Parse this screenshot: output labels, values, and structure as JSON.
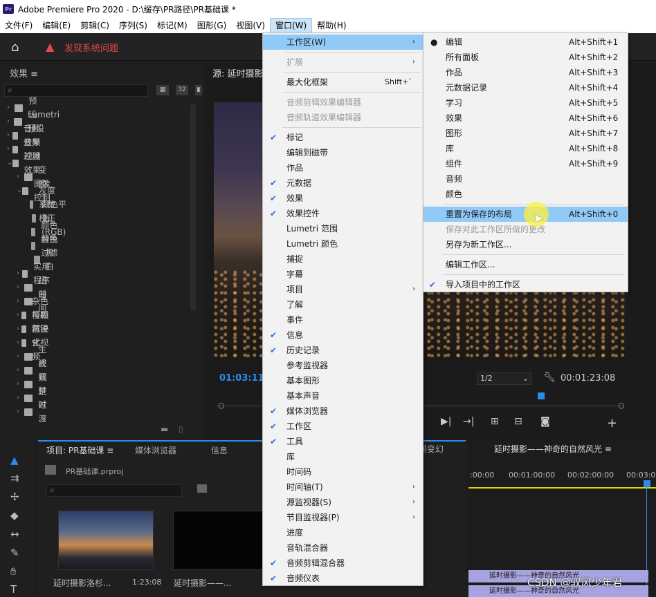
{
  "window_title": "Adobe Premiere Pro 2020 - D:\\缓存\\PR路径\\PR基础课 *",
  "app_logo": "Pr",
  "menubar": [
    "文件(F)",
    "编辑(E)",
    "剪辑(C)",
    "序列(S)",
    "标记(M)",
    "图形(G)",
    "视图(V)",
    "窗口(W)",
    "帮助(H)"
  ],
  "header": {
    "warning": "发现系统问题"
  },
  "effects": {
    "title": "效果",
    "tree": [
      {
        "label": "预设",
        "indent": 0,
        "kind": "folder",
        "open": false
      },
      {
        "label": "Lumetri 预设",
        "indent": 0,
        "kind": "folder",
        "open": false
      },
      {
        "label": "音频效果",
        "indent": 0,
        "kind": "folder",
        "open": false
      },
      {
        "label": "音频过渡",
        "indent": 0,
        "kind": "folder",
        "open": false
      },
      {
        "label": "视频效果",
        "indent": 0,
        "kind": "folder",
        "open": true
      },
      {
        "label": "变换",
        "indent": 1,
        "kind": "folder",
        "open": false
      },
      {
        "label": "图像控制",
        "indent": 1,
        "kind": "folder",
        "open": true
      },
      {
        "label": "灰度系数校正",
        "indent": 2,
        "kind": "fx"
      },
      {
        "label": "颜色平衡 (RGB)",
        "indent": 2,
        "kind": "fx"
      },
      {
        "label": "颜色替换",
        "indent": 2,
        "kind": "fx"
      },
      {
        "label": "颜色过滤",
        "indent": 2,
        "kind": "fx"
      },
      {
        "label": "黑白",
        "indent": 2,
        "kind": "fx"
      },
      {
        "label": "实用程序",
        "indent": 1,
        "kind": "folder",
        "open": false
      },
      {
        "label": "扭曲",
        "indent": 1,
        "kind": "folder",
        "open": false
      },
      {
        "label": "时间",
        "indent": 1,
        "kind": "folder",
        "open": false
      },
      {
        "label": "杂色与颗粒",
        "indent": 1,
        "kind": "folder",
        "open": false
      },
      {
        "label": "模糊与锐化",
        "indent": 1,
        "kind": "folder",
        "open": false
      },
      {
        "label": "沉浸式视频",
        "indent": 1,
        "kind": "folder",
        "open": false
      },
      {
        "label": "生成",
        "indent": 1,
        "kind": "folder",
        "open": false
      },
      {
        "label": "视频",
        "indent": 1,
        "kind": "folder",
        "open": false
      },
      {
        "label": "调整",
        "indent": 1,
        "kind": "folder",
        "open": false
      },
      {
        "label": "过时",
        "indent": 1,
        "kind": "folder",
        "open": false
      },
      {
        "label": "过渡",
        "indent": 1,
        "kind": "folder",
        "open": false
      }
    ],
    "tool_badges": [
      "32"
    ]
  },
  "source": {
    "tab": "源: 延时摄影",
    "timecode_in": "01:03:11:",
    "zoom": "1/2",
    "timecode_out": "00:01:23:08"
  },
  "project": {
    "tabs": [
      "项目: PR基础课",
      "媒体浏览器",
      "信息"
    ],
    "file": "PR基础课.prproj",
    "clips": [
      {
        "name": "延时摄影洛杉...",
        "duration": "1:23:08"
      },
      {
        "name": "延时摄影——..."
      }
    ]
  },
  "timeline": {
    "tab": "延时摄影——神奇的自然风光",
    "partial_tab": "间变幻",
    "ruler": [
      ":00:00",
      "00:01:00:00",
      "00:02:00:00",
      "00:03:00"
    ],
    "clip_label": "延时摄影——神奇的自然风光"
  },
  "window_menu": [
    {
      "label": "工作区(W)",
      "arrow": true,
      "highlight": true
    },
    {
      "sep": true
    },
    {
      "label": "扩展",
      "arrow": true,
      "disabled": true
    },
    {
      "sep": true
    },
    {
      "label": "最大化框架",
      "shortcut": "Shift+`"
    },
    {
      "sep": true
    },
    {
      "label": "音频剪辑效果编辑器",
      "disabled": true
    },
    {
      "label": "音频轨道效果编辑器",
      "disabled": true
    },
    {
      "sep": true
    },
    {
      "label": "标记",
      "checked": true
    },
    {
      "label": "编辑到磁带"
    },
    {
      "label": "作品"
    },
    {
      "label": "元数据",
      "checked": true
    },
    {
      "label": "效果",
      "checked": true
    },
    {
      "label": "效果控件",
      "checked": true
    },
    {
      "label": "Lumetri 范围"
    },
    {
      "label": "Lumetri 颜色"
    },
    {
      "label": "捕捉"
    },
    {
      "label": "字幕"
    },
    {
      "label": "项目",
      "arrow": true
    },
    {
      "label": "了解"
    },
    {
      "label": "事件"
    },
    {
      "label": "信息",
      "checked": true
    },
    {
      "label": "历史记录",
      "checked": true
    },
    {
      "label": "参考监视器"
    },
    {
      "label": "基本图形"
    },
    {
      "label": "基本声音"
    },
    {
      "label": "媒体浏览器",
      "checked": true
    },
    {
      "label": "工作区",
      "checked": true
    },
    {
      "label": "工具",
      "checked": true
    },
    {
      "label": "库"
    },
    {
      "label": "时间码"
    },
    {
      "label": "时间轴(T)",
      "arrow": true
    },
    {
      "label": "源监视器(S)",
      "arrow": true
    },
    {
      "label": "节目监视器(P)",
      "arrow": true
    },
    {
      "label": "进度"
    },
    {
      "label": "音轨混合器"
    },
    {
      "label": "音频剪辑混合器",
      "checked": true
    },
    {
      "label": "音频仪表",
      "checked": true
    }
  ],
  "workspace_menu": [
    {
      "label": "编辑",
      "shortcut": "Alt+Shift+1",
      "dot": true
    },
    {
      "label": "所有面板",
      "shortcut": "Alt+Shift+2"
    },
    {
      "label": "作品",
      "shortcut": "Alt+Shift+3"
    },
    {
      "label": "元数据记录",
      "shortcut": "Alt+Shift+4"
    },
    {
      "label": "学习",
      "shortcut": "Alt+Shift+5"
    },
    {
      "label": "效果",
      "shortcut": "Alt+Shift+6"
    },
    {
      "label": "图形",
      "shortcut": "Alt+Shift+7"
    },
    {
      "label": "库",
      "shortcut": "Alt+Shift+8"
    },
    {
      "label": "组件",
      "shortcut": "Alt+Shift+9"
    },
    {
      "label": "音频"
    },
    {
      "label": "颜色"
    },
    {
      "sep": true
    },
    {
      "label": "重置为保存的布局",
      "shortcut": "Alt+Shift+0",
      "highlight": true
    },
    {
      "label": "保存对此工作区所做的更改",
      "disabled": true
    },
    {
      "label": "另存为新工作区..."
    },
    {
      "sep": true
    },
    {
      "label": "编辑工作区..."
    },
    {
      "sep": true
    },
    {
      "label": "导入项目中的工作区",
      "checked": true
    }
  ],
  "watermark": "CSDN @驭风少年君"
}
